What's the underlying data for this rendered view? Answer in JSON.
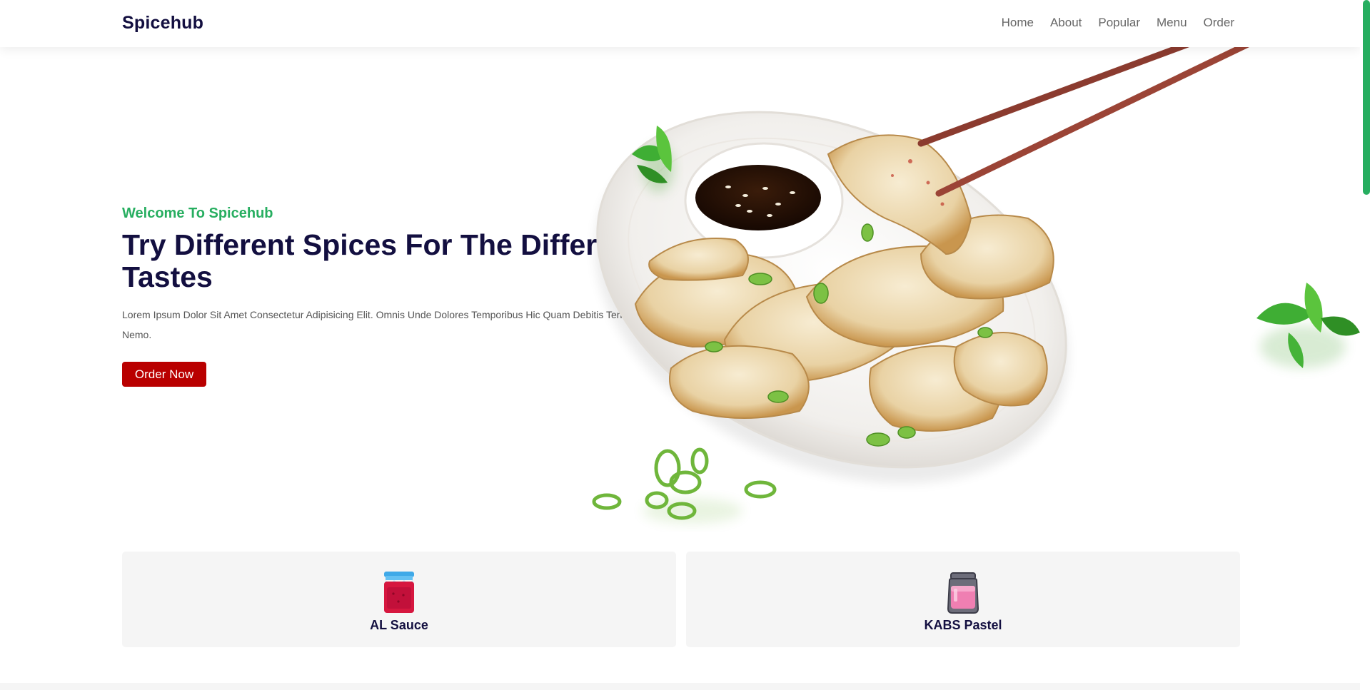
{
  "header": {
    "brand": "Spicehub",
    "nav": [
      "Home",
      "About",
      "Popular",
      "Menu",
      "Order"
    ]
  },
  "hero": {
    "welcome": "Welcome To Spicehub",
    "title": "Try Different Spices For The Different Tastes",
    "description": "Lorem Ipsum Dolor Sit Amet Consectetur Adipisicing Elit. Omnis Unde Dolores Temporibus Hic Quam Debitis Tenetur Harum Nemo.",
    "button_label": "Order Now",
    "image_subject": "dumplings-plate-with-soy-sauce-and-chopsticks"
  },
  "cards": [
    {
      "title": "AL Sauce",
      "icon": "red-jam-jar-icon"
    },
    {
      "title": "KABS Pastel",
      "icon": "pink-jam-jar-icon"
    }
  ],
  "colors": {
    "brand_text": "#130f40",
    "accent_green": "#27ae60",
    "button_red": "#b90000",
    "card_bg": "#f5f5f5"
  }
}
